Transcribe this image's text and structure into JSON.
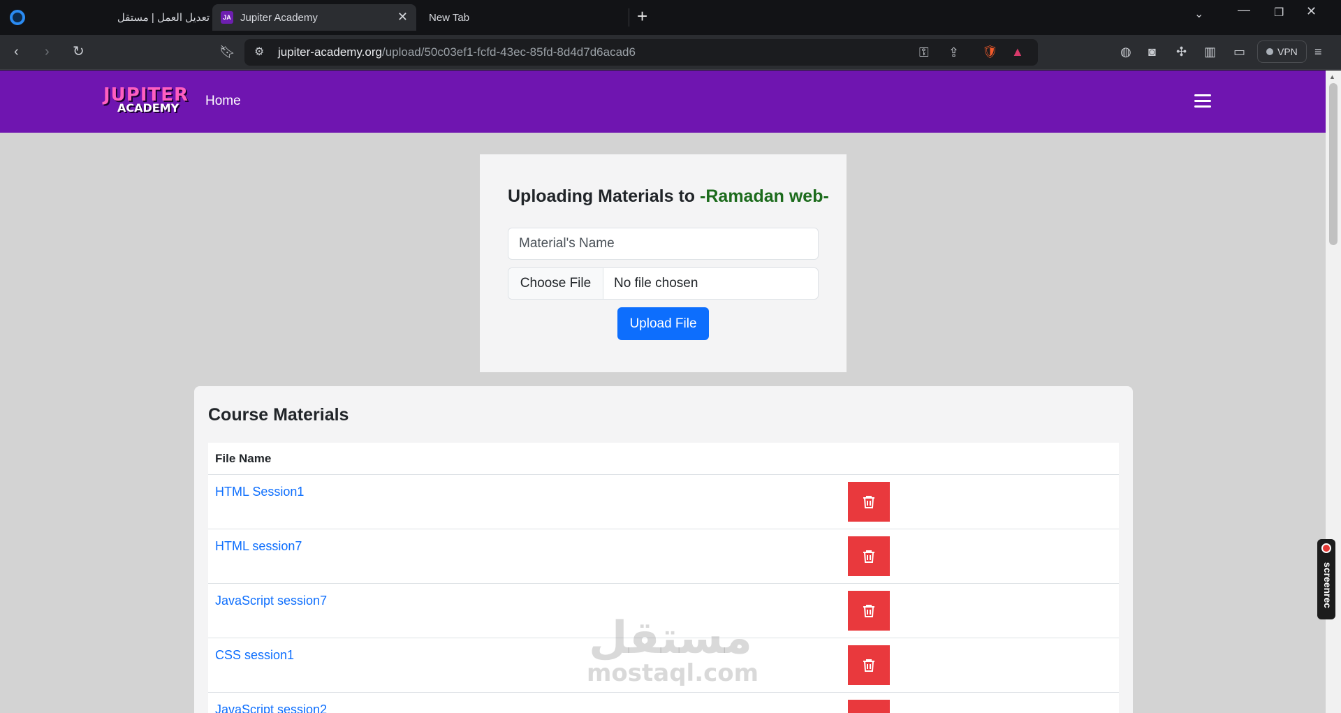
{
  "browser": {
    "tabs": [
      {
        "label": "تعديل العمل | مستقل",
        "active": false
      },
      {
        "label": "Jupiter Academy",
        "active": true
      },
      {
        "label": "New Tab",
        "active": false
      }
    ],
    "url_host": "jupiter-academy.org",
    "url_path": "/upload/50c03ef1-fcfd-43ec-85fd-8d4d7d6acad6",
    "vpn_label": "VPN",
    "favicon_text": "JA"
  },
  "navbar": {
    "logo_line1": "JUPITER",
    "logo_line2": "ACADEMY",
    "home_label": "Home",
    "brand_color": "#6f15b0"
  },
  "upload": {
    "title_prefix": "Uploading Materials to ",
    "course_name": "-Ramadan web-",
    "name_placeholder": "Material's Name",
    "choose_file_label": "Choose File",
    "no_file_label": "No file chosen",
    "upload_button": "Upload File"
  },
  "materials": {
    "title": "Course Materials",
    "column_header": "File Name",
    "rows": [
      {
        "name": "HTML Session1"
      },
      {
        "name": "HTML session7"
      },
      {
        "name": "JavaScript session7"
      },
      {
        "name": "CSS session1"
      },
      {
        "name": "JavaScript session2"
      }
    ],
    "delete_color": "#e9393d"
  },
  "overlay": {
    "watermark_ar": "مستقل",
    "watermark_en": "mostaql.com",
    "screenrec_label": "screenrec"
  }
}
